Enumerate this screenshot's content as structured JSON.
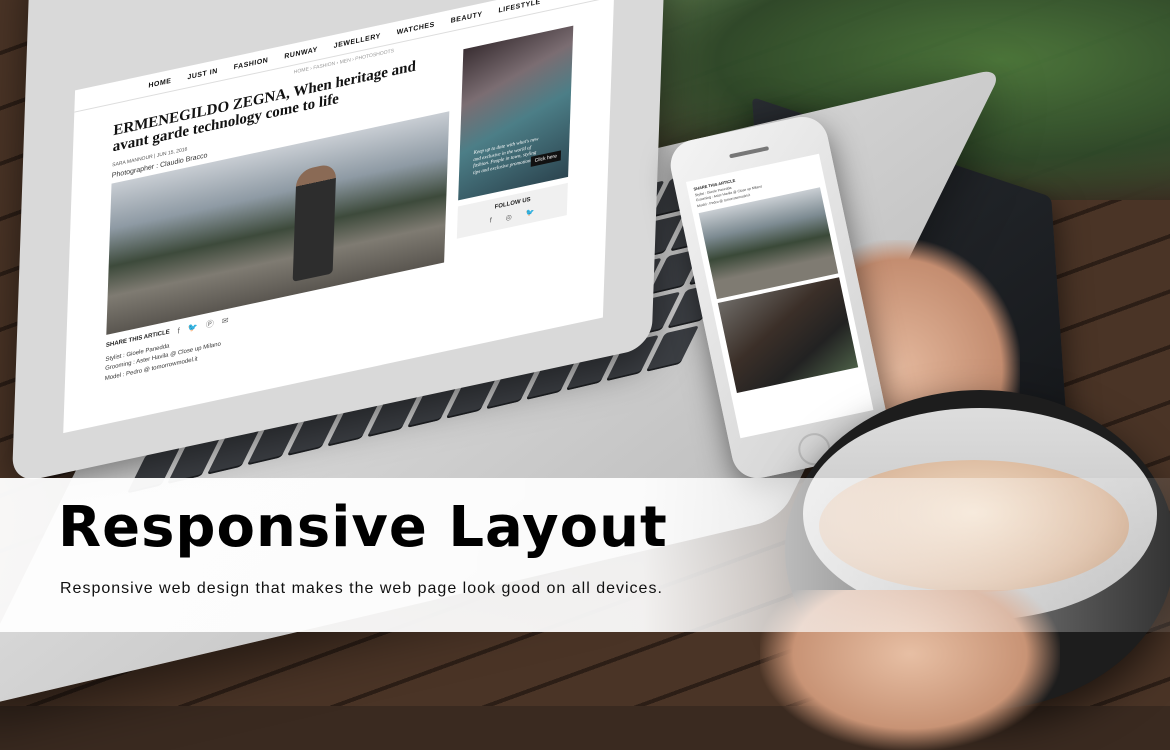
{
  "banner": {
    "headline": "Responsive Layout",
    "tagline": "Responsive web design that makes the web page look good on all devices."
  },
  "laptop_site": {
    "nav": [
      "HOME",
      "JUST IN",
      "FASHION",
      "RUNWAY",
      "JEWELLERY",
      "WATCHES",
      "BEAUTY",
      "LIFESTYLE"
    ],
    "breadcrumb": "HOME  ›  FASHION  ›  MEN  ›  PHOTOSHOOTS",
    "article_title": "ERMENEGILDO ZEGNA, When heritage and avant garde technology come to life",
    "meta": "SARA MANNOUR  |  JUN 15, 2016",
    "photographer": "Photographer : Claudio Bracco",
    "share_label": "SHARE THIS ARTICLE",
    "credits": [
      "Stylist : Gioele Panedda",
      "Grooming : Aster Havila @ Close up Milano",
      "Model : Pedro @ tomorrowmodel.it"
    ],
    "side_caption": "Keep up to date with what's new and exclusive in the world of fashion. People in town, styling tips and exclusive promotions.",
    "side_button": "Click here",
    "follow_label": "FOLLOW US"
  },
  "phone_site": {
    "share_label": "SHARE THIS ARTICLE",
    "credits": [
      "Stylist : Gioele Panedda",
      "Grooming : Aster Havila @ Close up Milano",
      "Model : Pedro @ tomorrowmodel.it"
    ]
  }
}
